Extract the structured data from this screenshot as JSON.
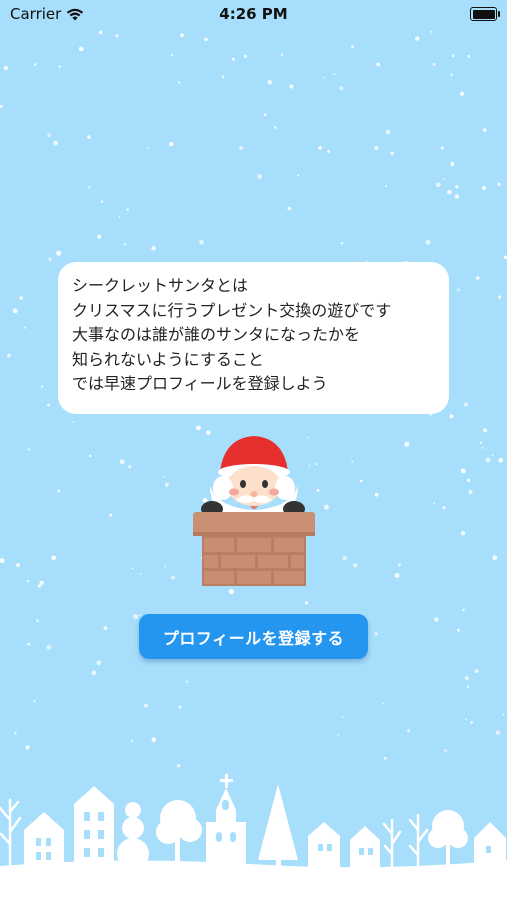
{
  "status_bar": {
    "carrier": "Carrier",
    "time": "4:26 PM",
    "wifi_icon": "wifi-icon",
    "battery_icon": "battery-icon"
  },
  "intro": {
    "lines": [
      "シークレットサンタとは",
      "クリスマスに行うプレゼント交換の遊びです",
      "大事なのは誰が誰のサンタになったかを",
      "知られないようにすること",
      "では早速プロフィールを登録しよう"
    ]
  },
  "illustration": {
    "santa": "santa-in-chimney-illustration",
    "town": "snowy-town-silhouette"
  },
  "register_button": {
    "label": "プロフィールを登録する"
  },
  "colors": {
    "sky": "#a6defb",
    "button": "#2596ef",
    "card": "#ffffff",
    "santa_hat": "#e5302d",
    "chimney": "#c88f73"
  }
}
